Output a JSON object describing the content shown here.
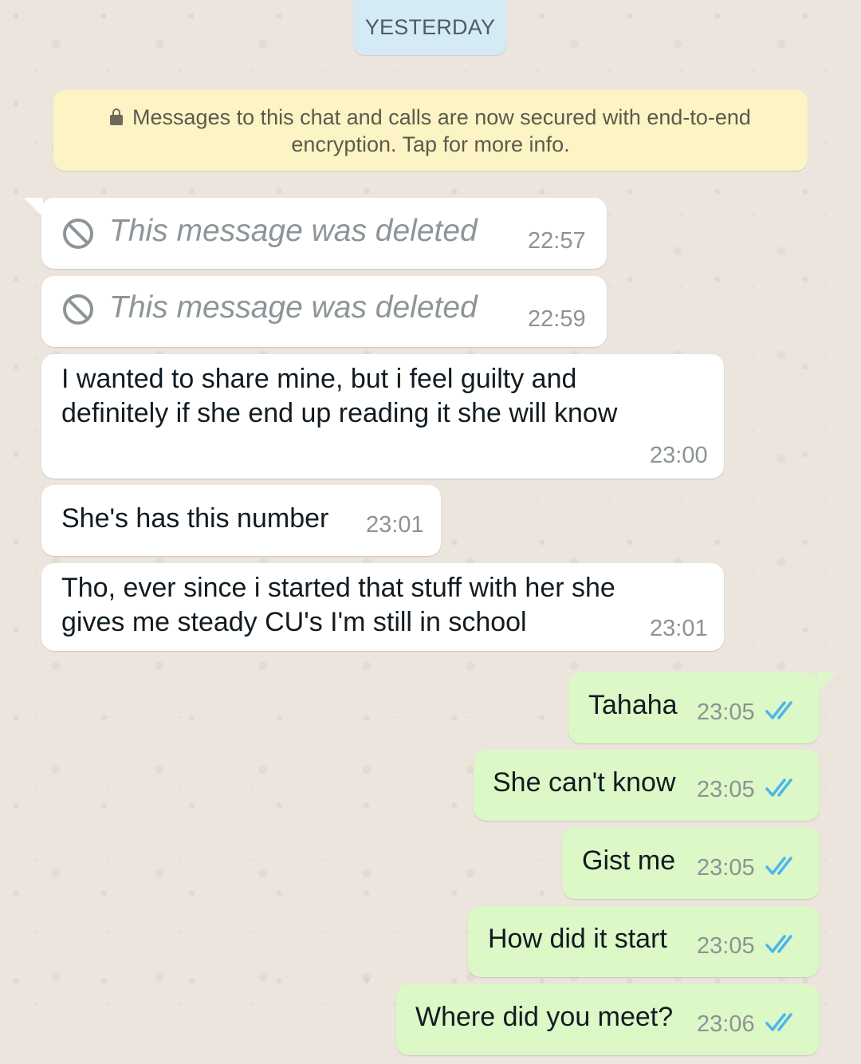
{
  "date_divider": "YESTERDAY",
  "encryption_notice": {
    "line1": "Messages to this chat and calls are now secured with end-to-end",
    "line2": "encryption. Tap for more info.",
    "icon": "lock-icon"
  },
  "messages": [
    {
      "direction": "incoming",
      "deleted": true,
      "text": "This message was deleted",
      "time": "22:57"
    },
    {
      "direction": "incoming",
      "deleted": true,
      "text": "This message was deleted",
      "time": "22:59"
    },
    {
      "direction": "incoming",
      "lines": [
        "I wanted to share mine, but i feel guilty and",
        "definitely if she end up reading it she will know"
      ],
      "time": "23:00"
    },
    {
      "direction": "incoming",
      "text": "She's has this number",
      "time": "23:01"
    },
    {
      "direction": "incoming",
      "lines": [
        "Tho, ever since i started that stuff with her she",
        "gives me steady CU's I'm still in school"
      ],
      "time": "23:01"
    },
    {
      "direction": "outgoing",
      "text": "Tahaha",
      "time": "23:05",
      "status": "read"
    },
    {
      "direction": "outgoing",
      "text": "She can't know",
      "time": "23:05",
      "status": "read"
    },
    {
      "direction": "outgoing",
      "text": "Gist me",
      "time": "23:05",
      "status": "read"
    },
    {
      "direction": "outgoing",
      "text": "How did it start",
      "time": "23:05",
      "status": "read"
    },
    {
      "direction": "outgoing",
      "text": "Where did you meet?",
      "time": "23:06",
      "status": "read"
    }
  ],
  "colors": {
    "chat_background": "#ece5dd",
    "incoming_bubble": "#ffffff",
    "outgoing_bubble": "#dcf8c6",
    "date_chip": "#d4eaf4",
    "encryption_banner": "#fcf4c4",
    "read_ticks": "#4fb6ec"
  }
}
